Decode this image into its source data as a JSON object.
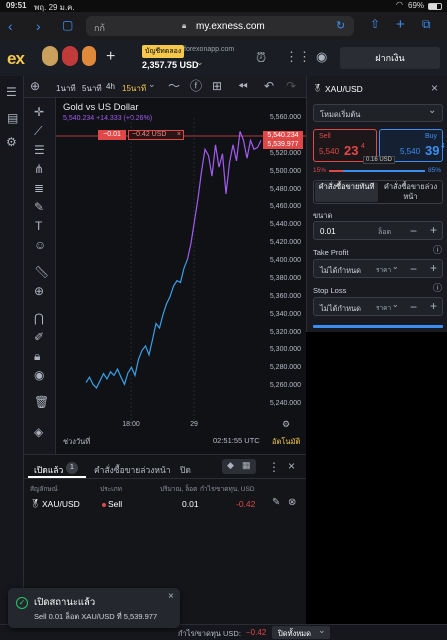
{
  "status": {
    "time": "09:51",
    "date": "พฤ. 29 ม.ค.",
    "battery": "69%"
  },
  "safari": {
    "tab_text": "กก้",
    "url": "my.exness.com",
    "lock": "lock-icon"
  },
  "appbar": {
    "logo": "ex",
    "account_type": "บัญชีทดลอง",
    "server": "forexonapp.com",
    "balance": "2,357.75 USD",
    "deposit_label": "ฝากเงิน"
  },
  "charttools": {
    "tf_1m": "1นาที",
    "tf_5m": "5นาที",
    "tf_4h": "4h",
    "tf_15m": "15นาที"
  },
  "chart": {
    "title": "Gold vs US Dollar",
    "price_line": "5,540.234 +14.333 (+0.26%)",
    "order_price": "−0.01",
    "order_pl": "−0.42 USD",
    "tag_price1": "5,540.234",
    "tag_price2": "5,539.977",
    "time_label": "02:51:55 UTC",
    "range_label": "ช่วงวันที่",
    "auto_label": "อัตโนมัติ"
  },
  "chart_data": {
    "type": "line",
    "y_ticks": [
      "5,560.000",
      "5,540.000",
      "5,520.000",
      "5,500.000",
      "5,480.000",
      "5,460.000",
      "5,440.000",
      "5,420.000",
      "5,400.000",
      "5,380.000",
      "5,360.000",
      "5,340.000",
      "5,320.000",
      "5,300.000",
      "5,280.000",
      "5,260.000",
      "5,240.000"
    ],
    "x_ticks": [
      "18:00",
      "29"
    ],
    "ylim": [
      5240,
      5560
    ],
    "series": [
      {
        "values": [
          5264,
          5270,
          5262,
          5258,
          5266,
          5274,
          5268,
          5276,
          5272,
          5279,
          5270,
          5262,
          5275,
          5281,
          5272,
          5290,
          5300,
          5305,
          5295,
          5312,
          5330,
          5325,
          5340,
          5352,
          5360,
          5372,
          5378,
          5376,
          5392,
          5402
        ]
      },
      {
        "values": [
          5402,
          5420,
          5445,
          5470,
          5500,
          5525,
          5518,
          5495,
          5530,
          5505,
          5520,
          5475,
          5510,
          5530,
          5512,
          5545,
          5535,
          5515,
          5535,
          5525,
          5527,
          5535
        ]
      }
    ]
  },
  "orderpanel": {
    "symbol": "XAU/USD",
    "mode": "โหมดเริ่มต้น",
    "sell_label": "Sell",
    "sell_price_main": "5,540",
    "sell_price_big": "23",
    "sell_price_sup": "4",
    "buy_label": "Buy",
    "buy_price_main": "5,540",
    "buy_price_big": "39",
    "buy_price_sup": "4",
    "spread": "0.16 USD",
    "sentiment_sell": "15%",
    "sentiment_buy": "85%",
    "tab_market": "คำสั่งซื้อขายทันที",
    "tab_pending": "คำสั่งซื้อขายล่วงหน้า",
    "volume_label": "ขนาด",
    "volume_value": "0.01",
    "volume_unit": "ล็อต",
    "tp_label": "Take Profit",
    "tp_value": "ไม่ได้กำหนด",
    "tp_unit": "ราคา",
    "sl_label": "Stop Loss",
    "sl_value": "ไม่ได้กำหนด",
    "sl_unit": "ราคา"
  },
  "positions": {
    "tab_open": "เปิดแล้ว",
    "tab_open_count": "1",
    "tab_pending": "คำสั่งซื้อขายล่วงหน้า",
    "tab_closed": "ปิด",
    "col_symbol": "สัญลักษณ์",
    "col_type": "ประเภท",
    "col_volume": "ปริมาณ, ล็อต",
    "col_pl": "กำไร/ขาดทุน, USD",
    "row_symbol": "XAU/USD",
    "row_type": "Sell",
    "row_volume": "0.01",
    "row_pl": "-0.42"
  },
  "footer": {
    "pl_label": "กำไร/ขาดทุน USD:",
    "pl_value": "−0.42",
    "close_all": "ปิดทั้งหมด"
  },
  "toast": {
    "title": "เปิดสถานะแล้ว",
    "body": "Sell 0.01 ล็อต XAU/USD ที่ 5,539.977"
  },
  "colors": {
    "accent": "#f5c84c",
    "sell": "#e04848",
    "buy": "#3b8ff3",
    "line_blue": "#3aa0e8",
    "line_purple": "#a35cf0",
    "ok": "#27c46a"
  }
}
